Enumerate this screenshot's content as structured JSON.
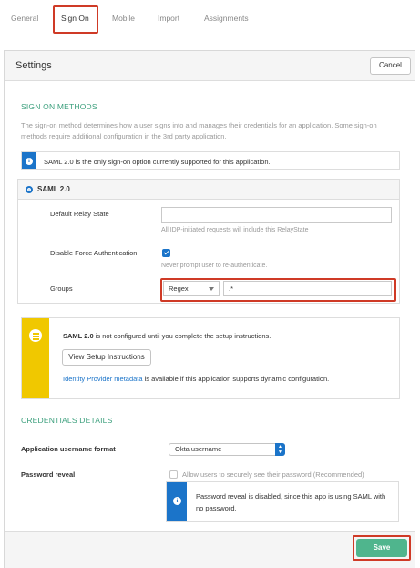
{
  "tabs": [
    {
      "label": "General"
    },
    {
      "label": "Sign On"
    },
    {
      "label": "Mobile"
    },
    {
      "label": "Import"
    },
    {
      "label": "Assignments"
    }
  ],
  "settings": {
    "title": "Settings",
    "cancel_label": "Cancel"
  },
  "sign_on_methods": {
    "heading": "SIGN ON METHODS",
    "description": "The sign-on method determines how a user signs into and manages their credentials for an application. Some sign-on methods require additional configuration in the 3rd party application.",
    "info_text": "SAML 2.0 is the only sign-on option currently supported for this application.",
    "saml_label": "SAML 2.0",
    "default_relay_state": {
      "label": "Default Relay State",
      "value": "",
      "hint": "All IDP-initiated requests will include this RelayState"
    },
    "disable_force_auth": {
      "label": "Disable Force Authentication",
      "checked": true,
      "hint": "Never prompt user to re-authenticate."
    },
    "groups": {
      "label": "Groups",
      "filter_type": "Regex",
      "value": ".*"
    }
  },
  "setup": {
    "text_bold": "SAML 2.0",
    "text_rest": " is not configured until you complete the setup instructions.",
    "button_label": "View Setup Instructions",
    "link_text": "Identity Provider metadata",
    "footer_rest": " is available if this application supports dynamic configuration."
  },
  "credentials": {
    "heading": "CREDENTIALS DETAILS",
    "username_format_label": "Application username format",
    "username_format_value": "Okta username",
    "password_reveal_label": "Password reveal",
    "password_reveal_option": "Allow users to securely see their password (Recommended)",
    "password_reveal_checked": false,
    "password_info": "Password reveal is disabled, since this app is using SAML with no password."
  },
  "footer": {
    "save_label": "Save"
  },
  "colors": {
    "accent_blue": "#1b74c9",
    "section_green": "#3b9f7c",
    "save_green": "#4fb58d",
    "warning_yellow": "#f0c800",
    "highlight_red": "#cf3a26"
  }
}
